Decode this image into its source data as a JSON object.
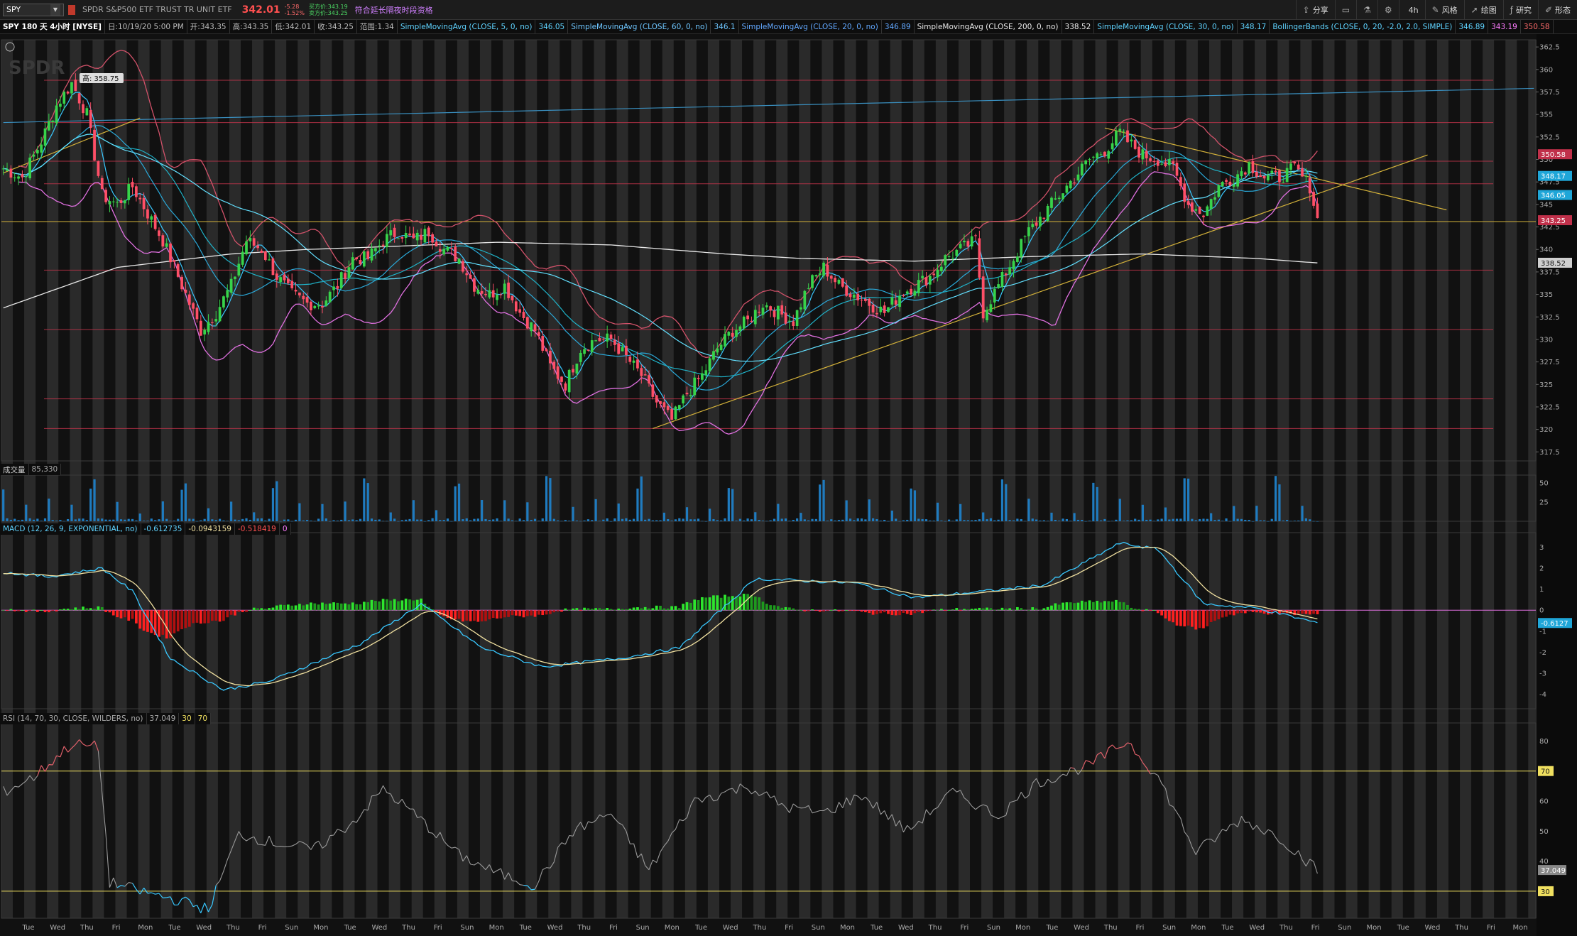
{
  "toolbar": {
    "symbol": "SPY",
    "description": "SPDR S&P500 ETF TRUST TR UNIT ETF",
    "last_price": "342.01",
    "change": "-5.28",
    "change_pct": "-1.52%",
    "bid": "买方价:343.19",
    "ask": "卖方价:343.25",
    "extended_hours": "符合延长隔夜时段资格",
    "buttons": [
      "分享",
      "",
      "",
      "",
      "4h",
      "风格",
      "绘图",
      "研究",
      "形态"
    ],
    "button_icons": [
      "share-icon",
      "page-icon",
      "flask-icon",
      "gear-icon",
      "clock-icon",
      "style-icon",
      "cursor-icon",
      "study-icon",
      "pattern-icon"
    ]
  },
  "studies": {
    "title": "SPY 180 天 4小时 [NYSE]",
    "date": "日:10/19/20 5:00 PM",
    "open": "开:343.35",
    "high": "高:343.35",
    "low": "低:342.01",
    "close": "收:343.25",
    "range": "范围:1.34",
    "sma5": "SimpleMovingAvg (CLOSE, 5, 0, no)",
    "sma5_val": "346.05",
    "sma60": "SimpleMovingAvg (CLOSE, 60, 0, no)",
    "sma60_val": "346.1",
    "sma20": "SimpleMovingAvg (CLOSE, 20, 0, no)",
    "sma20_val": "346.89",
    "sma200": "SimpleMovingAvg (CLOSE, 200, 0, no)",
    "sma200_val": "338.52",
    "sma30": "SimpleMovingAvg (CLOSE, 30, 0, no)",
    "sma30_val": "348.17",
    "bb": "BollingerBands (CLOSE, 0, 20, -2.0, 2.0, SIMPLE)",
    "bb_mid": "346.89",
    "bb_low": "343.19",
    "bb_up": "350.58"
  },
  "volume_label": {
    "name": "成交量",
    "value": "85,330"
  },
  "macd_label": {
    "name": "MACD (12, 26, 9, EXPONENTIAL, no)",
    "v1": "-0.612735",
    "v2": "-0.0943159",
    "v3": "-0.518419",
    "v4": "0"
  },
  "rsi_label": {
    "name": "RSI (14, 70, 30, CLOSE, WILDERS, no)",
    "v1": "37.049",
    "v2": "30",
    "v3": "70"
  },
  "colors": {
    "up": "#37d34a",
    "down": "#ff4f67",
    "bb": "#e070e0",
    "sma5": "#5fd3ff",
    "sma200": "#e8e8e8",
    "hline": "#c0344a",
    "support": "#d4b23a",
    "trend_blue": "#3a8fbf"
  },
  "chart_data": {
    "type": "candlestick",
    "symbol": "SPY",
    "timeframe": "4h",
    "price_axis": {
      "ticks": [
        317.5,
        320,
        322.5,
        325,
        327.5,
        330,
        332.5,
        335,
        337.5,
        340,
        342.5,
        345,
        347.5,
        350,
        352.5,
        355,
        357.5,
        360,
        362.5
      ],
      "range": [
        316.5,
        363.3
      ]
    },
    "price_badges": [
      {
        "label": "350.58",
        "value": 350.58,
        "color": "#c0304a"
      },
      {
        "label": "348.17",
        "value": 348.17,
        "color": "#1fa6d8"
      },
      {
        "label": "346.05",
        "value": 346.05,
        "color": "#1fa6d8"
      },
      {
        "label": "343.25",
        "value": 343.25,
        "color": "#c0304a"
      },
      {
        "label": "338.52",
        "value": 338.52,
        "color": "#cfcfcf"
      }
    ],
    "high_marker": "高: 358.75",
    "x_axis_days": [
      "Tue",
      "Wed",
      "Thu",
      "Fri",
      "Mon",
      "Tue",
      "Wed",
      "Thu",
      "Fri",
      "Sun",
      "Mon",
      "Tue",
      "Wed",
      "Thu",
      "Fri",
      "Sun",
      "Mon",
      "Tue",
      "Wed",
      "Thu",
      "Fri",
      "Sun",
      "Mon",
      "Tue",
      "Wed",
      "Thu",
      "Fri",
      "Sun",
      "Mon",
      "Tue",
      "Wed",
      "Thu",
      "Fri",
      "Sun",
      "Mon",
      "Tue",
      "Wed",
      "Thu",
      "Fri",
      "Sun",
      "Mon",
      "Tue",
      "Wed",
      "Thu",
      "Fri",
      "Sun",
      "Mon",
      "Tue",
      "Wed",
      "Thu",
      "Fri",
      "Mon"
    ],
    "close_anchors": [
      [
        0,
        349
      ],
      [
        5,
        348
      ],
      [
        10,
        352
      ],
      [
        14,
        356
      ],
      [
        18,
        358.5
      ],
      [
        22,
        355
      ],
      [
        26,
        346
      ],
      [
        30,
        345
      ],
      [
        34,
        347
      ],
      [
        38,
        344
      ],
      [
        42,
        341
      ],
      [
        46,
        337
      ],
      [
        50,
        333
      ],
      [
        52,
        331
      ],
      [
        56,
        333
      ],
      [
        60,
        336
      ],
      [
        64,
        341
      ],
      [
        68,
        340
      ],
      [
        72,
        337
      ],
      [
        76,
        335
      ],
      [
        80,
        334
      ],
      [
        84,
        334
      ],
      [
        88,
        336
      ],
      [
        92,
        339
      ],
      [
        96,
        339
      ],
      [
        100,
        341
      ],
      [
        104,
        342
      ],
      [
        108,
        341
      ],
      [
        112,
        342
      ],
      [
        116,
        340
      ],
      [
        120,
        339
      ],
      [
        124,
        336
      ],
      [
        128,
        335
      ],
      [
        132,
        336
      ],
      [
        136,
        333
      ],
      [
        140,
        331
      ],
      [
        144,
        327
      ],
      [
        148,
        325
      ],
      [
        152,
        329
      ],
      [
        156,
        330
      ],
      [
        160,
        330
      ],
      [
        164,
        328
      ],
      [
        168,
        326
      ],
      [
        172,
        323
      ],
      [
        176,
        321
      ],
      [
        180,
        324
      ],
      [
        184,
        326
      ],
      [
        188,
        329
      ],
      [
        192,
        331
      ],
      [
        196,
        332
      ],
      [
        200,
        334
      ],
      [
        204,
        333
      ],
      [
        208,
        332
      ],
      [
        212,
        336
      ],
      [
        216,
        338
      ],
      [
        220,
        336
      ],
      [
        224,
        335
      ],
      [
        228,
        334
      ],
      [
        232,
        333
      ],
      [
        236,
        335
      ],
      [
        240,
        336
      ],
      [
        244,
        337
      ],
      [
        248,
        339
      ],
      [
        252,
        340
      ],
      [
        256,
        341
      ],
      [
        258,
        333
      ],
      [
        262,
        336
      ],
      [
        266,
        339
      ],
      [
        270,
        342
      ],
      [
        274,
        344
      ],
      [
        278,
        346
      ],
      [
        282,
        348
      ],
      [
        286,
        350
      ],
      [
        290,
        351
      ],
      [
        294,
        353
      ],
      [
        296,
        352
      ],
      [
        300,
        350.5
      ],
      [
        304,
        350
      ],
      [
        308,
        349
      ],
      [
        312,
        345
      ],
      [
        316,
        344
      ],
      [
        320,
        347
      ],
      [
        324,
        348
      ],
      [
        328,
        349.5
      ],
      [
        332,
        348
      ],
      [
        336,
        348
      ],
      [
        340,
        349
      ],
      [
        344,
        347
      ],
      [
        346,
        343.3
      ]
    ],
    "sma200_anchors": [
      [
        0,
        333.5
      ],
      [
        30,
        338
      ],
      [
        60,
        339.5
      ],
      [
        80,
        340
      ],
      [
        100,
        340.3
      ],
      [
        130,
        340.8
      ],
      [
        160,
        340.5
      ],
      [
        190,
        339.5
      ],
      [
        210,
        339
      ],
      [
        240,
        338.7
      ],
      [
        270,
        339.2
      ],
      [
        300,
        339.5
      ],
      [
        330,
        339
      ],
      [
        346,
        338.5
      ]
    ],
    "horizontal_levels": [
      358.8,
      349.8,
      347.3,
      343.1,
      337.7,
      331.1,
      323.4,
      320.1,
      354.1
    ],
    "support_level": 343.1,
    "trendlines": [
      {
        "name": "ascending",
        "from": [
          171,
          320.1
        ],
        "to": [
          375,
          350.5
        ]
      },
      {
        "name": "descending",
        "from": [
          290,
          353.5
        ],
        "to": [
          380,
          344.4
        ]
      },
      {
        "name": "long-term",
        "from": [
          0,
          354.1
        ],
        "to": [
          403,
          357.9
        ]
      },
      {
        "name": "short-channel",
        "from": [
          0,
          348.5
        ],
        "to": [
          36,
          354.6
        ]
      }
    ],
    "volume_axis": {
      "ticks": [
        25,
        50
      ]
    },
    "macd_axis": {
      "ticks": [
        -4,
        -3,
        -2,
        -1,
        0,
        1,
        2,
        3
      ],
      "badge": "-0.6127"
    },
    "macd_anchors": [
      [
        0,
        1.8
      ],
      [
        12,
        1.6
      ],
      [
        26,
        2.0
      ],
      [
        34,
        0.9
      ],
      [
        44,
        -2.3
      ],
      [
        58,
        -3.8
      ],
      [
        70,
        -3.4
      ],
      [
        82,
        -2.5
      ],
      [
        94,
        -1.6
      ],
      [
        110,
        0.3
      ],
      [
        126,
        -1.8
      ],
      [
        142,
        -2.7
      ],
      [
        162,
        -2.3
      ],
      [
        178,
        -1.8
      ],
      [
        198,
        1.5
      ],
      [
        224,
        1.3
      ],
      [
        240,
        0.6
      ],
      [
        258,
        0.9
      ],
      [
        274,
        1.2
      ],
      [
        294,
        3.2
      ],
      [
        304,
        2.9
      ],
      [
        316,
        0.3
      ],
      [
        330,
        0.1
      ],
      [
        346,
        -0.6
      ]
    ],
    "rsi_axis": {
      "ticks": [
        30,
        40,
        50,
        60,
        70,
        80
      ],
      "overbought": 70,
      "oversold": 30,
      "badge": "37.049"
    },
    "rsi_anchors": [
      [
        0,
        63
      ],
      [
        8,
        68
      ],
      [
        18,
        79
      ],
      [
        25,
        78
      ],
      [
        28,
        33
      ],
      [
        36,
        30
      ],
      [
        46,
        27
      ],
      [
        54,
        24
      ],
      [
        62,
        49
      ],
      [
        72,
        46
      ],
      [
        82,
        44
      ],
      [
        92,
        53
      ],
      [
        100,
        64
      ],
      [
        108,
        56
      ],
      [
        120,
        42
      ],
      [
        130,
        36
      ],
      [
        140,
        32
      ],
      [
        150,
        50
      ],
      [
        160,
        56
      ],
      [
        170,
        37
      ],
      [
        182,
        60
      ],
      [
        196,
        65
      ],
      [
        206,
        58
      ],
      [
        216,
        56
      ],
      [
        226,
        62
      ],
      [
        238,
        50
      ],
      [
        250,
        63
      ],
      [
        262,
        55
      ],
      [
        272,
        66
      ],
      [
        286,
        72
      ],
      [
        296,
        80
      ],
      [
        304,
        68
      ],
      [
        314,
        43
      ],
      [
        326,
        54
      ],
      [
        336,
        48
      ],
      [
        346,
        37
      ]
    ]
  }
}
